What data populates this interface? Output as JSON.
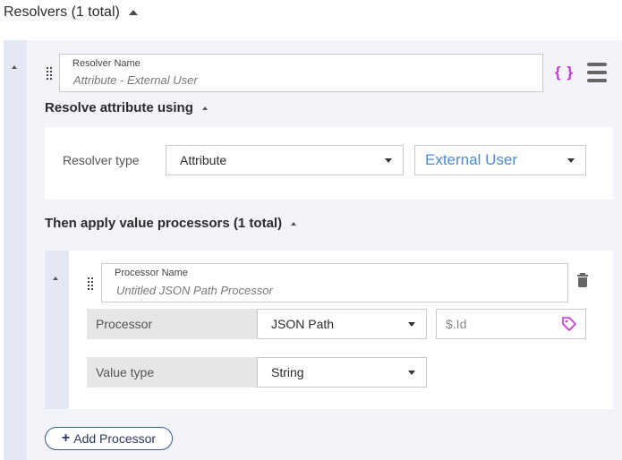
{
  "resolvers": {
    "title": "Resolvers (1 total)",
    "resolver": {
      "name_label": "Resolver Name",
      "name_value": "Attribute - External User",
      "braces_glyph": "{ }",
      "resolve_section_title": "Resolve attribute using",
      "resolver_type_label": "Resolver type",
      "resolver_type_value": "Attribute",
      "attribute_value": "External User",
      "processors_section_title": "Then apply value processors (1 total)",
      "processor": {
        "name_label": "Processor Name",
        "name_value": "Untitled JSON Path Processor",
        "processor_label": "Processor",
        "processor_value": "JSON Path",
        "path_placeholder": "$.Id",
        "value_type_label": "Value type",
        "value_type_value": "String"
      },
      "add_processor_label": "Add Processor"
    }
  },
  "colors": {
    "panel_bg": "#f3f4fa",
    "side_strip": "#e4e8f4",
    "accent_purple": "#c832d6",
    "link_blue": "#4e8bd1",
    "button_border": "#3a5a92"
  },
  "icons": {
    "collapse": "caret-up-icon",
    "drag": "drag-handle-icon",
    "code": "braces-icon",
    "menu": "hamburger-menu-icon",
    "delete": "trash-icon",
    "tag": "tag-icon",
    "add": "plus-icon"
  }
}
